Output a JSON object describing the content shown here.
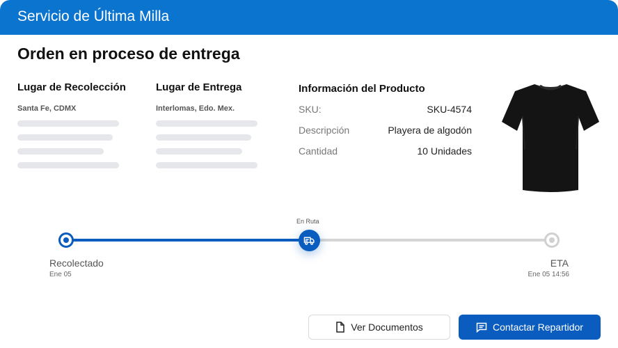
{
  "header": {
    "title": "Servicio de Última Milla"
  },
  "order": {
    "title": "Orden en proceso de entrega"
  },
  "pickup": {
    "title": "Lugar de Recolección",
    "address": "Santa Fe, CDMX"
  },
  "delivery": {
    "title": "Lugar de Entrega",
    "address": "Interlomas, Edo. Mex."
  },
  "product": {
    "title": "Información del Producto",
    "rows": [
      {
        "label": "SKU:",
        "value": "SKU-4574"
      },
      {
        "label": "Descripción",
        "value": "Playera de algodón"
      },
      {
        "label": "Cantidad",
        "value": "10 Unidades"
      }
    ],
    "image_icon": "black-tshirt-image"
  },
  "timeline": {
    "progress_fraction": 0.5,
    "steps": [
      {
        "label": "Recolectado",
        "date": "Ene 05",
        "status": "done"
      },
      {
        "label": "En Ruta",
        "date": "",
        "status": "current",
        "icon": "truck-icon"
      },
      {
        "label": "ETA",
        "date": "Ene 05 14:56",
        "status": "pending"
      }
    ]
  },
  "actions": {
    "documents_label": "Ver Documentos",
    "contact_label": "Contactar Repartidor"
  },
  "colors": {
    "header": "#0a74cf",
    "primary": "#0a5cbf",
    "pending": "#d5d5d5"
  }
}
